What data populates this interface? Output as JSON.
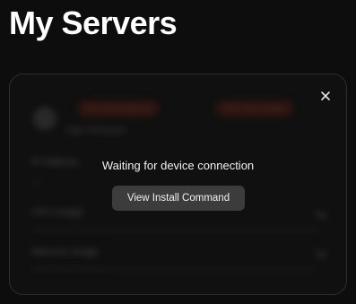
{
  "page": {
    "title": "My Servers"
  },
  "server_card": {
    "server_name": "Ugo Rompani",
    "badges": [
      "SSH Misconfigured",
      "UFW Not Installed"
    ],
    "rows": {
      "ip_address": "IP Address",
      "cpu_usage": "CPU Usage",
      "memory_usage": "Memory Usage"
    }
  },
  "overlay": {
    "message": "Waiting for device connection",
    "button_label": "View Install Command",
    "close_icon": "close-icon"
  },
  "colors": {
    "background": "#0d0d0d",
    "card_background": "#141414",
    "badge_background": "#5a1f16",
    "badge_text": "#ff7a5c",
    "button_background": "#3c3c3c"
  }
}
